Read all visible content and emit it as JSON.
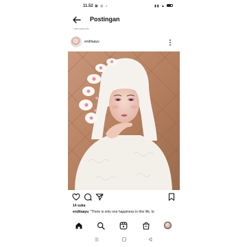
{
  "status_bar": {
    "time": "11.52",
    "app_icons": "▣ ◎ ♪",
    "right_icons": "▮▮ ▲"
  },
  "header": {
    "title": "Postingan",
    "subcaption": "1 jam yang lalu"
  },
  "post": {
    "username": "enditaayu",
    "likes": "14 suka",
    "caption_user": "enditaayu",
    "caption_text": "\"There is only one happiness in this life, to"
  },
  "icons": {
    "back": "arrow-left-icon",
    "more": "more-vertical-icon",
    "like": "heart-icon",
    "comment": "comment-icon",
    "share": "send-icon",
    "save": "bookmark-icon",
    "home": "home-icon",
    "search": "search-icon",
    "reels": "reels-icon",
    "shop": "shop-icon",
    "profile": "profile-avatar",
    "recents": "recents-icon",
    "home_system": "system-home-icon",
    "back_system": "system-back-icon"
  },
  "colors": {
    "accent": "#111111",
    "photo_background": "#b98766",
    "veil": "#f5f2ee",
    "flower_pink": "#e98aa8"
  }
}
